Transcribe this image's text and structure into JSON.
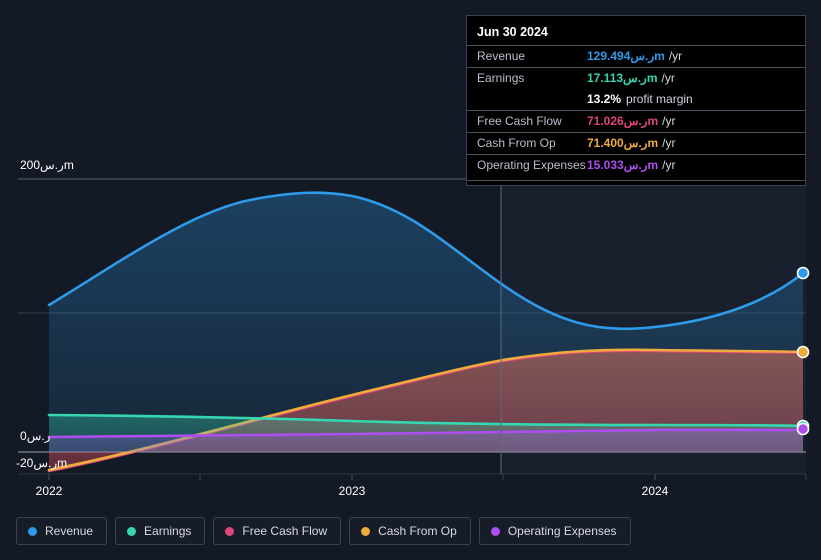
{
  "currency_symbol": "ر.س",
  "tooltip": {
    "date": "Jun 30 2024",
    "rows": [
      {
        "label": "Revenue",
        "value": "129.494ر.سm",
        "unit": "/yr",
        "color": "#2e9bea"
      },
      {
        "label": "Earnings",
        "value": "17.113ر.سm",
        "unit": "/yr",
        "color": "#36d6b0"
      },
      {
        "label": "Free Cash Flow",
        "value": "71.026ر.سm",
        "unit": "/yr",
        "color": "#e0447c"
      },
      {
        "label": "Cash From Op",
        "value": "71.400ر.سm",
        "unit": "/yr",
        "color": "#eeab3e"
      },
      {
        "label": "Operating Expenses",
        "value": "15.033ر.سm",
        "unit": "/yr",
        "color": "#ad4ef0"
      }
    ],
    "profit_margin_value": "13.2%",
    "profit_margin_label": "profit margin"
  },
  "axis": {
    "y_top_label": "200ر.سm",
    "y_zero_label": "0ر.س",
    "y_neg_label": "-20ر.سm",
    "x_labels": [
      "2022",
      "2023",
      "2024"
    ]
  },
  "legend": {
    "items": [
      {
        "label": "Revenue",
        "color": "#2e9bea"
      },
      {
        "label": "Earnings",
        "color": "#36d6b0"
      },
      {
        "label": "Free Cash Flow",
        "color": "#e0447c"
      },
      {
        "label": "Cash From Op",
        "color": "#eeab3e"
      },
      {
        "label": "Operating Expenses",
        "color": "#ad4ef0"
      }
    ]
  },
  "chart_data": {
    "type": "area",
    "title": "",
    "xlabel": "",
    "ylabel": "ر.س m",
    "ylim": [
      -20,
      200
    ],
    "y_ticks": [
      200,
      100,
      0,
      -20
    ],
    "x": [
      "2022",
      "2022.5",
      "2023",
      "2023.5",
      "2024",
      "2024.5"
    ],
    "x_ticks": [
      "2022",
      "2023",
      "2024"
    ],
    "grid": true,
    "legend_position": "bottom",
    "forecast_divider_x": "2023.35",
    "series": [
      {
        "name": "Revenue",
        "color": "#2e9bea",
        "values": [
          98,
          168,
          183,
          148,
          124,
          129.494
        ]
      },
      {
        "name": "Earnings",
        "color": "#36d6b0",
        "values": [
          21,
          20,
          19,
          18,
          17,
          17.113
        ]
      },
      {
        "name": "Free Cash Flow",
        "color": "#e0447c",
        "values": [
          -19,
          -3,
          25,
          52,
          68,
          71.026
        ]
      },
      {
        "name": "Cash From Op",
        "color": "#eeab3e",
        "values": [
          -19,
          -3,
          25,
          52,
          69,
          71.4
        ]
      },
      {
        "name": "Operating Expenses",
        "color": "#ad4ef0",
        "values": [
          10,
          11,
          12,
          13,
          14,
          15.033
        ]
      }
    ]
  }
}
